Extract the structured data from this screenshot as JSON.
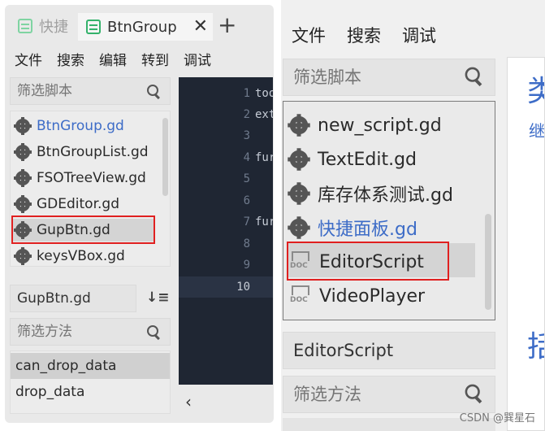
{
  "left": {
    "tabs": [
      {
        "label": "快捷",
        "active": false
      },
      {
        "label": "BtnGroup",
        "active": true
      }
    ],
    "tab_close": "✕",
    "tab_add": "+",
    "menu": [
      "文件",
      "搜索",
      "编辑",
      "转到",
      "调试"
    ],
    "script_filter_placeholder": "筛选脚本",
    "scripts": [
      {
        "label": "BtnGroup.gd",
        "current": true
      },
      {
        "label": "BtnGroupList.gd",
        "current": false
      },
      {
        "label": "FSOTreeView.gd",
        "current": false
      },
      {
        "label": "GDEditor.gd",
        "current": false
      },
      {
        "label": "GupBtn.gd",
        "current": false,
        "selected": true
      },
      {
        "label": "keysVBox.gd",
        "current": false
      }
    ],
    "method_panel_title": "GupBtn.gd",
    "method_filter_placeholder": "筛选方法",
    "methods": [
      {
        "label": "can_drop_data",
        "selected": true
      },
      {
        "label": "drop_data",
        "selected": false
      }
    ],
    "editor": {
      "line_numbers": [
        "1",
        "2",
        "3",
        "4",
        "5",
        "6",
        "7",
        "8",
        "9",
        "10"
      ],
      "code_lines": [
        "too",
        "ext",
        "",
        "fur",
        "",
        "",
        "fur",
        "",
        "",
        ""
      ],
      "current_line": "10"
    },
    "collapse_glyph": "‹"
  },
  "right": {
    "menu": [
      "文件",
      "搜索",
      "调试"
    ],
    "script_filter_placeholder": "筛选脚本",
    "scripts": [
      {
        "label": "new_script.gd",
        "icon": "gear-icon",
        "current": false
      },
      {
        "label": "TextEdit.gd",
        "icon": "gear-icon",
        "current": false
      },
      {
        "label": "库存体系测试.gd",
        "icon": "gear-icon",
        "current": false
      },
      {
        "label": "快捷面板.gd",
        "icon": "gear-icon",
        "current": true
      },
      {
        "label": "EditorScript",
        "icon": "doc-icon",
        "current": false,
        "selected": true
      },
      {
        "label": "VideoPlayer",
        "icon": "doc-icon",
        "current": false
      }
    ],
    "doc_icon_text": "DOC",
    "method_panel_title": "EditorScript",
    "method_filter_placeholder": "筛选方法",
    "doc_preview": {
      "heading": "类",
      "subtext": "继",
      "lower": "括"
    }
  },
  "watermark": "CSDN @巽星石",
  "colors": {
    "accent_blue": "#3d6cc7",
    "highlight_red": "#e02020",
    "editor_bg": "#1f2633",
    "tab_icon_green": "#34b26b"
  }
}
